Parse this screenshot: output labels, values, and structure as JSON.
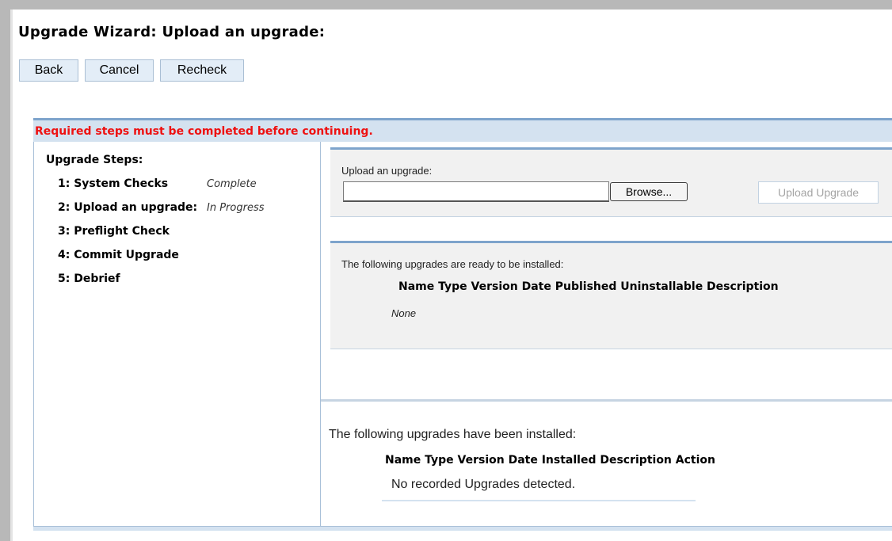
{
  "page": {
    "title": "Upgrade Wizard: Upload an upgrade:"
  },
  "toolbar": {
    "back_label": "Back",
    "cancel_label": "Cancel",
    "recheck_label": "Recheck"
  },
  "warning": {
    "text": "Required steps must be completed before continuing.",
    "color": "#ee1111"
  },
  "steps": {
    "heading": "Upgrade Steps:",
    "items": [
      {
        "label": "1: System Checks",
        "status": "Complete"
      },
      {
        "label": "2: Upload an upgrade:",
        "status": "In Progress"
      },
      {
        "label": "3: Preflight Check",
        "status": ""
      },
      {
        "label": "4: Commit Upgrade",
        "status": ""
      },
      {
        "label": "5: Debrief",
        "status": ""
      }
    ]
  },
  "upload": {
    "label": "Upload an upgrade:",
    "file_value": "",
    "browse_label": "Browse...",
    "upload_button_label": "Upload Upgrade",
    "upload_button_state": "disabled"
  },
  "ready": {
    "label": "The following upgrades are ready to be installed:",
    "columns": "Name Type Version Date Published Uninstallable Description",
    "empty_text": "None"
  },
  "installed": {
    "label": "The following upgrades have been installed:",
    "columns": "Name Type Version Date Installed Description Action",
    "empty_text": "No recorded Upgrades detected."
  },
  "colors": {
    "accent_border": "#7ea4cc",
    "panel_blue": "#d4e2f0",
    "box_gray": "#f1f1f1"
  }
}
